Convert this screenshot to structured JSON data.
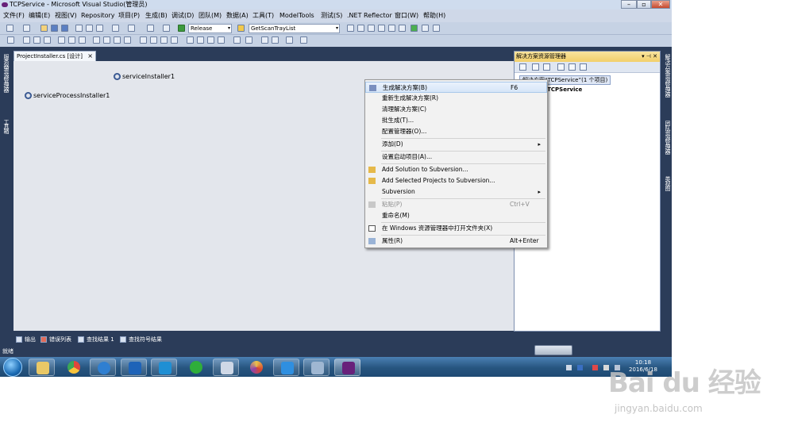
{
  "window": {
    "title": "TCPService - Microsoft Visual Studio(管理员)",
    "btn_min": "–",
    "btn_max": "▫",
    "btn_close": "✕"
  },
  "menubar": [
    "文件(F)",
    "编辑(E)",
    "视图(V)",
    "Repository",
    "项目(P)",
    "生成(B)",
    "调试(D)",
    "团队(M)",
    "数据(A)",
    "工具(T)",
    "ModelTools",
    "测试(S)",
    ".NET Reflector",
    "窗口(W)",
    "帮助(H)"
  ],
  "toolbar": {
    "config": "Release",
    "target": "GetScanTrayList"
  },
  "left_strip": {
    "tab1": "服务器资源管理器",
    "tab2": "工具箱"
  },
  "editor": {
    "tab_label": "ProjectInstaller.cs [设计]",
    "tab_close": "×",
    "components": [
      "serviceInstaller1",
      "serviceProcessInstaller1"
    ]
  },
  "solution_explorer": {
    "title": "解决方案资源管理器",
    "header_controls": "▾ ⊣ ✕",
    "solution_node": "解决方案“TCPService”(1 个项目)",
    "project_node": "TCPService",
    "project_prefix": "P"
  },
  "right_strip": {
    "tab1": "解决方案资源管理器",
    "tab2": "团队资源管理器",
    "tab3": "类视图"
  },
  "context_menu": [
    {
      "label": "生成解决方案(B)",
      "shortcut": "F6",
      "highlighted": true,
      "icon": "build-icon"
    },
    {
      "label": "重新生成解决方案(R)"
    },
    {
      "label": "清理解决方案(C)"
    },
    {
      "label": "批生成(T)..."
    },
    {
      "label": "配置管理器(O)..."
    },
    {
      "label": "添加(D)",
      "submenu": true
    },
    {
      "label": "设置启动项目(A)..."
    },
    {
      "label": "Add Solution to Subversion...",
      "icon": "subversion-icon"
    },
    {
      "label": "Add Selected Projects to Subversion...",
      "icon": "subversion-icon"
    },
    {
      "label": "Subversion",
      "submenu": true
    },
    {
      "label": "粘贴(P)",
      "shortcut": "Ctrl+V",
      "disabled": true,
      "icon": "paste-icon"
    },
    {
      "label": "重命名(M)"
    },
    {
      "label": "在 Windows 资源管理器中打开文件夹(X)",
      "icon": "open-folder-icon"
    },
    {
      "label": "属性(R)",
      "shortcut": "Alt+Enter",
      "icon": "properties-icon"
    }
  ],
  "submenu_arrow": "▸",
  "output_tabs": [
    "输出",
    "错误列表",
    "查找结果 1",
    "查找符号结果"
  ],
  "status": "就绪",
  "clock": {
    "time": "10:18",
    "date": "2016/6/18"
  },
  "watermark": {
    "logo": "Bai du 经验",
    "url": "jingyan.baidu.com"
  }
}
